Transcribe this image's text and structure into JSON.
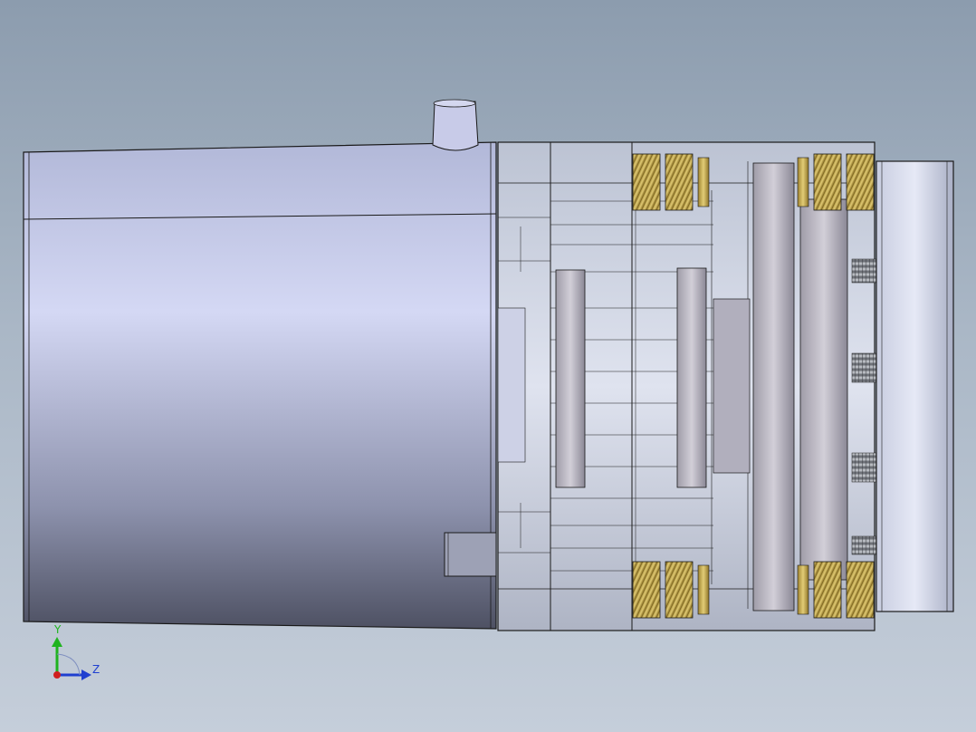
{
  "viewport": {
    "background_top": "#8c9cae",
    "background_bottom": "#c5ceda"
  },
  "model": {
    "body_color": "#b8bedb",
    "housing_color": "#c6ccd8",
    "gear_color": "#c4a94a",
    "edge_color": "#1a1a1a",
    "parts": [
      "motor-housing",
      "cable-gland",
      "side-port",
      "gearbox-flange",
      "planetary-gear-set",
      "ring-gear-set",
      "output-flange"
    ]
  },
  "triad": {
    "y_label": "Y",
    "z_label": "Z",
    "y_color": "#1fb31f",
    "z_color": "#1f3fd0",
    "x_color": "#d01f1f"
  }
}
